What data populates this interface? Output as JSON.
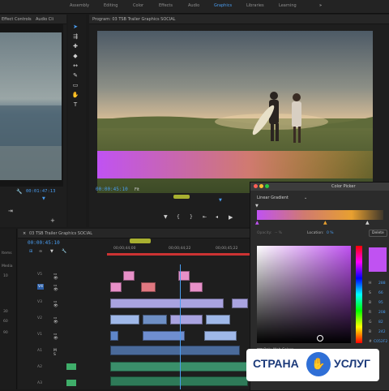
{
  "workspaces": [
    "Assembly",
    "Editing",
    "Color",
    "Effects",
    "Audio",
    "Graphics",
    "Libraries",
    "Learning"
  ],
  "active_workspace": "Graphics",
  "menu_icon": "»",
  "source_panel": {
    "tabs": [
      "Effect Controls",
      "Audio Cli"
    ],
    "timecode": "00:01:47:13",
    "wrench": "wrench-icon"
  },
  "program_panel": {
    "title": "Program: 03 TSB Trailer Graphics SOCIAL",
    "timecode": "00:00:45:10",
    "fit": "Fit"
  },
  "timeline_panel": {
    "title": "03 TSB Trailer Graphics SOCIAL",
    "timecode": "00:00:45:10",
    "ruler": [
      "00;00;44;00",
      "00;00;44;22",
      "00;00;45;22"
    ],
    "track_labels": [
      "V5",
      "V4",
      "V3",
      "V2",
      "V1",
      "A1",
      "A2",
      "A3"
    ]
  },
  "left_panel": {
    "labels": [
      "Items",
      "Media",
      "10",
      "30",
      "60",
      "90"
    ]
  },
  "color_picker": {
    "title": "Color Picker",
    "mode": "Linear Gradient",
    "opacity_label": "Opacity:",
    "opacity_value": "-- %",
    "location_label": "Location:",
    "location_value": "0 %",
    "delete_label": "Delete",
    "fields": [
      {
        "label": "H",
        "value": "288"
      },
      {
        "label": "S",
        "value": "66"
      },
      {
        "label": "B",
        "value": "95"
      },
      {
        "label": "R",
        "value": "208"
      },
      {
        "label": "G",
        "value": "82"
      },
      {
        "label": "B",
        "value": "242"
      }
    ],
    "hex_label": "#",
    "hex_value": "C052F2",
    "only_web": "Only Web Colors",
    "swatch_color": "#c052f2"
  },
  "watermark": {
    "text": "СТРАНА",
    "text2": "УСЛУГ"
  },
  "colors": {
    "accent": "#4a9df0",
    "gradient_start": "#c052f2",
    "gradient_end": "#e8a030"
  }
}
